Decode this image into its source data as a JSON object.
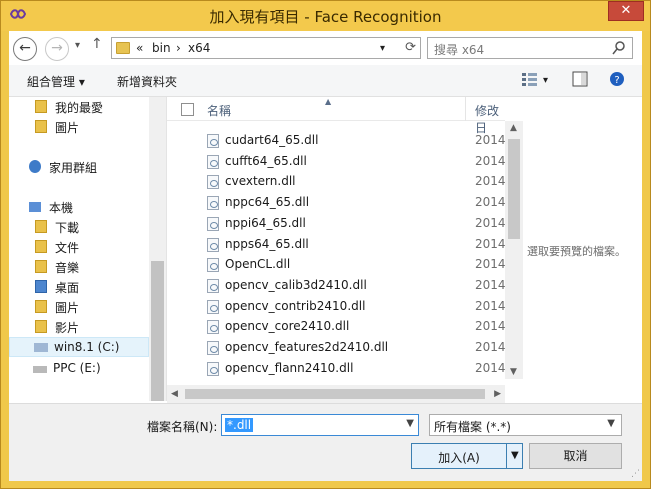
{
  "window": {
    "title": "加入現有項目 - Face Recognition",
    "close_label": "✕"
  },
  "address_bar": {
    "overflow": "«",
    "crumbs": [
      "bin",
      "x64"
    ],
    "separator": "›",
    "refresh_icon": "refresh-icon"
  },
  "search": {
    "placeholder": "搜尋 x64"
  },
  "toolbar": {
    "organize_label": "組合管理 ▾",
    "new_folder_label": "新增資料夾"
  },
  "nav": {
    "favorites": [
      "我的最愛",
      "圖片"
    ],
    "homegroup": "家用群組",
    "this_pc": "本機",
    "pc_items": [
      "下載",
      "文件",
      "音樂",
      "桌面",
      "圖片",
      "影片"
    ],
    "drives": [
      {
        "label": "win8.1 (C:)",
        "selected": true
      },
      {
        "label": "PPC (E:)",
        "selected": false
      }
    ]
  },
  "file_list": {
    "col_name": "名稱",
    "col_modified": "修改日",
    "files": [
      {
        "name": "cudart64_65.dll",
        "date": "2014/"
      },
      {
        "name": "cufft64_65.dll",
        "date": "2014/"
      },
      {
        "name": "cvextern.dll",
        "date": "2014/"
      },
      {
        "name": "nppc64_65.dll",
        "date": "2014/"
      },
      {
        "name": "nppi64_65.dll",
        "date": "2014/"
      },
      {
        "name": "npps64_65.dll",
        "date": "2014/"
      },
      {
        "name": "OpenCL.dll",
        "date": "2014/"
      },
      {
        "name": "opencv_calib3d2410.dll",
        "date": "2014/"
      },
      {
        "name": "opencv_contrib2410.dll",
        "date": "2014/"
      },
      {
        "name": "opencv_core2410.dll",
        "date": "2014/"
      },
      {
        "name": "opencv_features2d2410.dll",
        "date": "2014/"
      },
      {
        "name": "opencv_flann2410.dll",
        "date": "2014/"
      }
    ]
  },
  "preview": {
    "text": "選取要預覽的檔案。"
  },
  "bottom": {
    "filename_label": "檔案名稱(N):",
    "filename_value": "*.dll",
    "filetype_value": "所有檔案 (*.*)",
    "add_label": "加入(A)",
    "cancel_label": "取消"
  },
  "colors": {
    "titlebar": "#f3c94c",
    "accent": "#3399ff",
    "close": "#c74a3a"
  }
}
